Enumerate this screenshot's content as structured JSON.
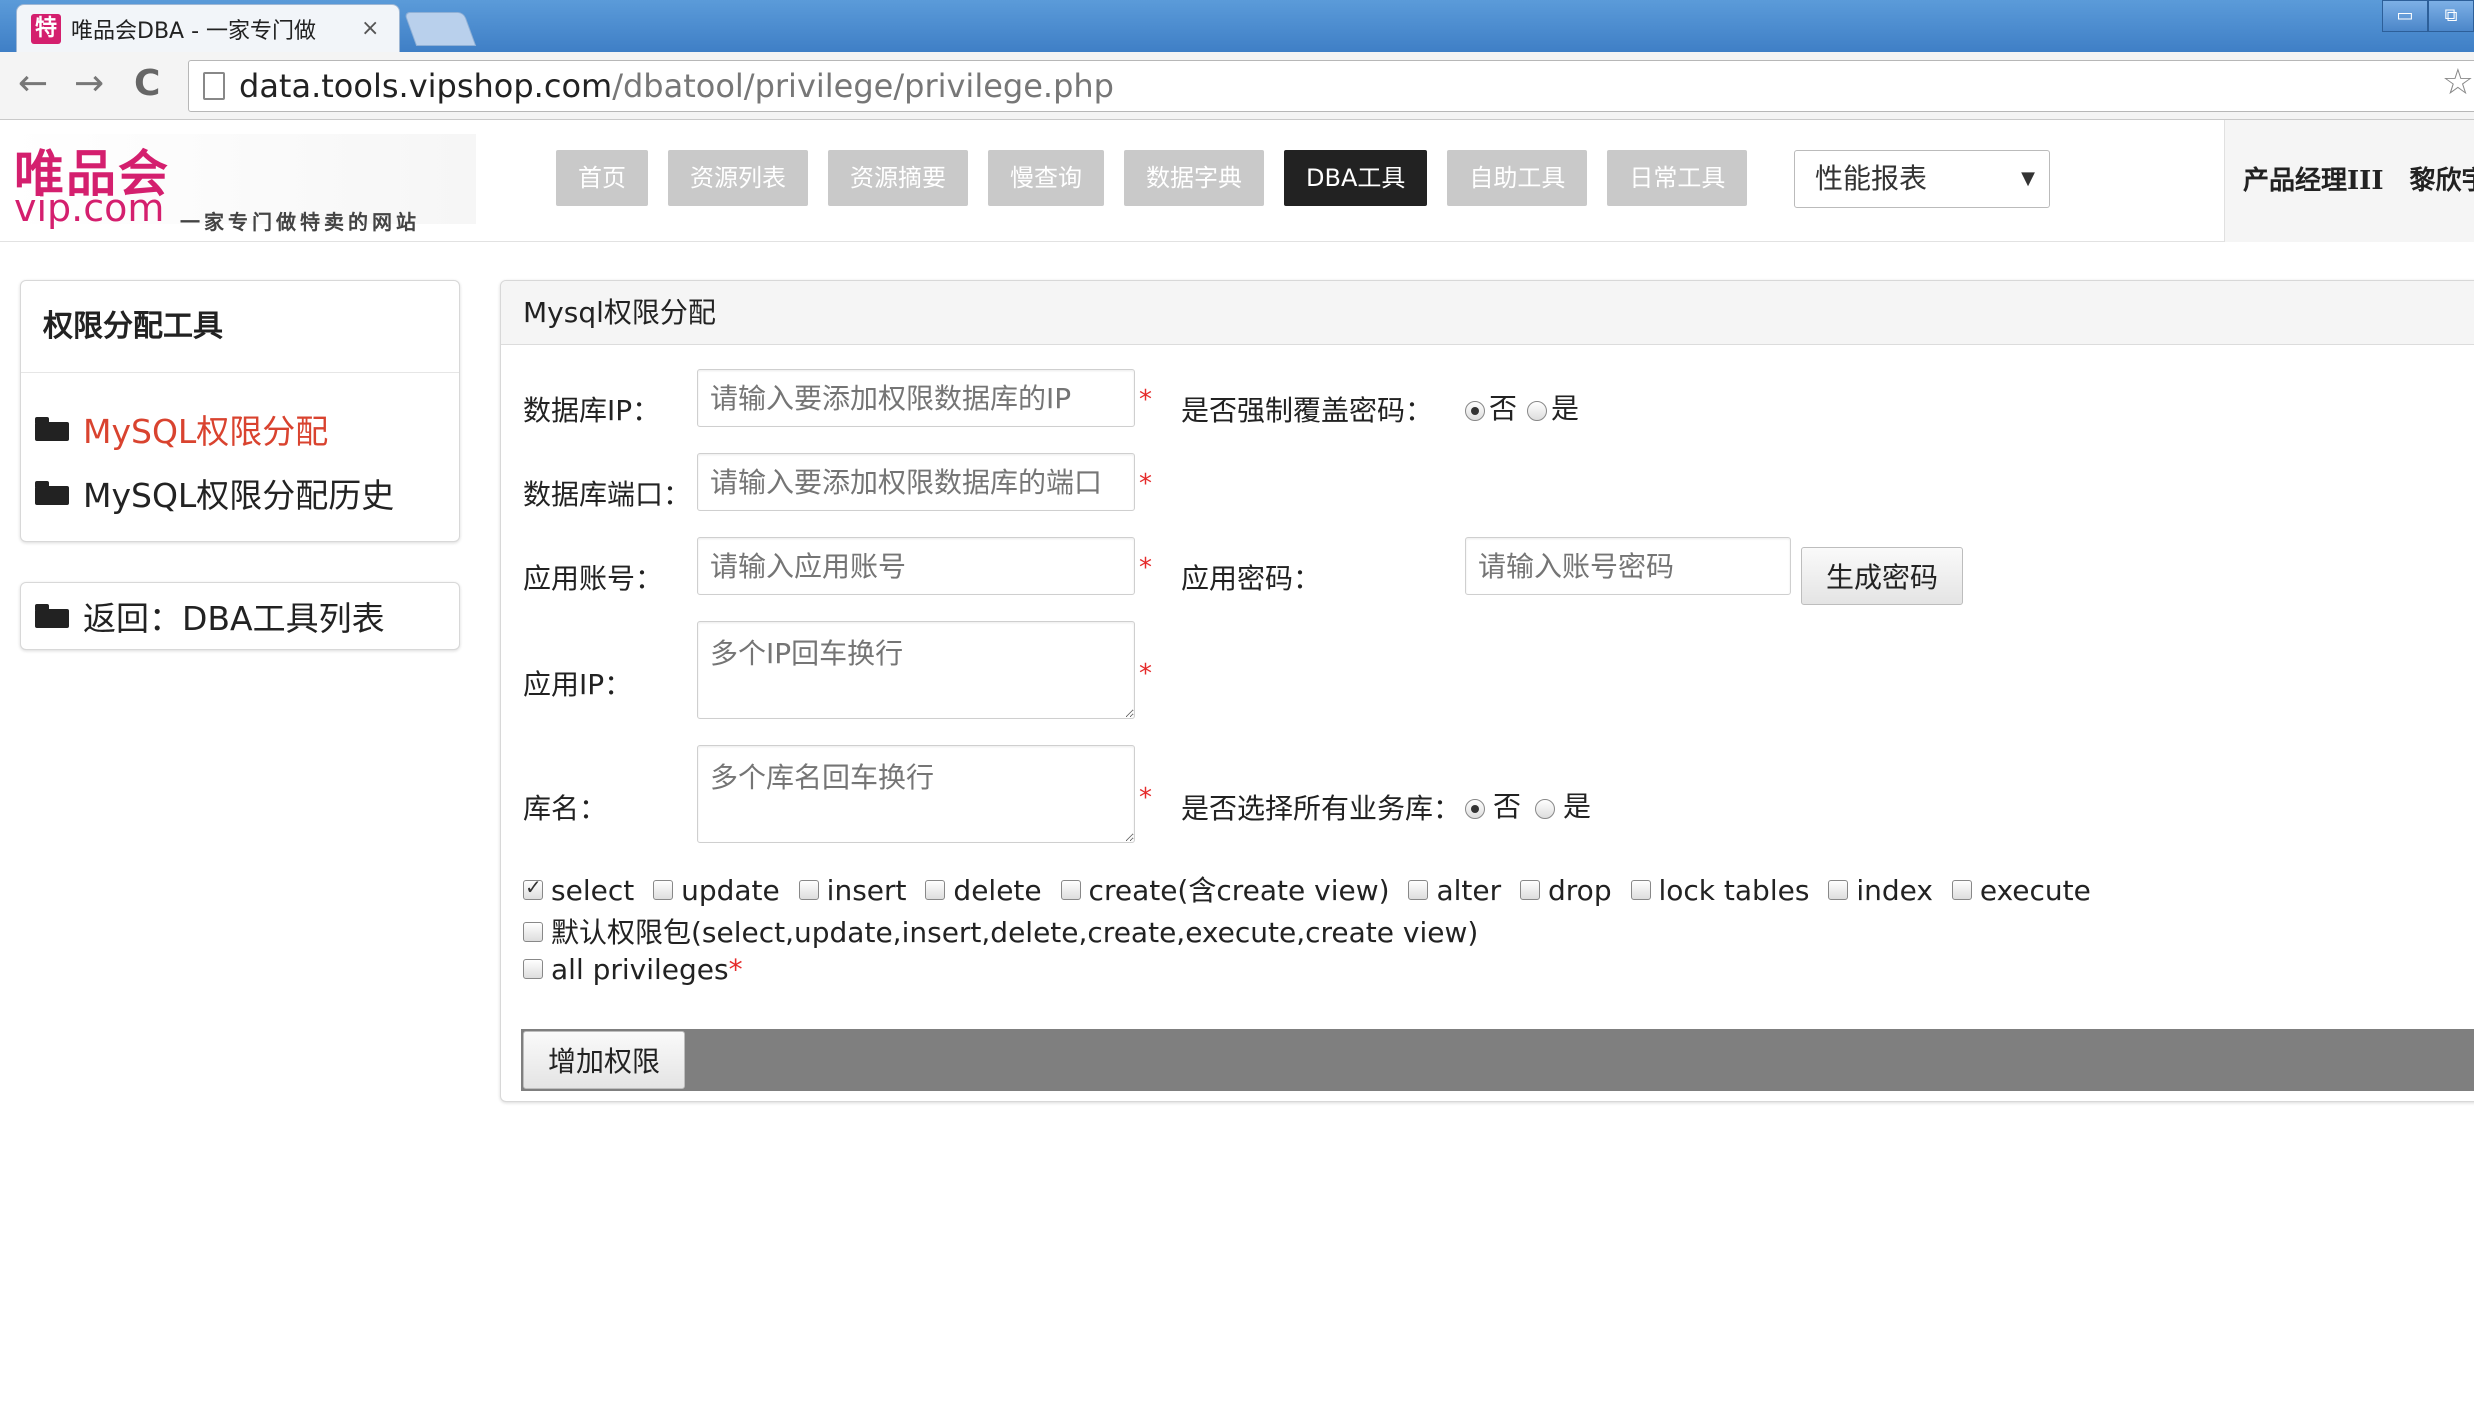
{
  "browser": {
    "tab_title": "唯品会DBA - 一家专门做",
    "favicon_text": "特",
    "close_glyph": "×",
    "url_host": "data.tools.vipshop.com",
    "url_path": "/dbatool/privilege/privilege.php",
    "back_glyph": "←",
    "forward_glyph": "→",
    "reload_glyph": "C",
    "star_glyph": "☆",
    "win_min": "▭",
    "win_restore": "⧉"
  },
  "site": {
    "logo_cn": "唯品会",
    "logo_en": "vip.com",
    "logo_slogan": "一家专门做特卖的网站",
    "nav": [
      {
        "label": "首页"
      },
      {
        "label": "资源列表"
      },
      {
        "label": "资源摘要"
      },
      {
        "label": "慢查询"
      },
      {
        "label": "数据字典"
      },
      {
        "label": "DBA工具"
      },
      {
        "label": "自助工具"
      },
      {
        "label": "日常工具"
      }
    ],
    "nav_select": "性能报表",
    "user": "产品经理III　黎欣宇"
  },
  "sidebar": {
    "title": "权限分配工具",
    "items": [
      {
        "label": "MySQL权限分配"
      },
      {
        "label": "MySQL权限分配历史"
      }
    ],
    "back_label": "返回：DBA工具列表"
  },
  "form": {
    "panel_title": "Mysql权限分配",
    "db_ip_label": "数据库IP：",
    "db_ip_placeholder": "请输入要添加权限数据库的IP",
    "force_pw_label": "是否强制覆盖密码：",
    "no": "否",
    "yes": "是",
    "db_port_label": "数据库端口：",
    "db_port_placeholder": "请输入要添加权限数据库的端口",
    "app_account_label": "应用账号：",
    "app_account_placeholder": "请输入应用账号",
    "app_pw_label": "应用密码：",
    "app_pw_placeholder": "请输入账号密码",
    "gen_pw_button": "生成密码",
    "app_ip_label": "应用IP：",
    "app_ip_placeholder": "多个IP回车换行",
    "db_name_label": "库名：",
    "db_name_placeholder": "多个库名回车换行",
    "all_db_label": "是否选择所有业务库：",
    "required_mark": "*",
    "privileges": [
      {
        "label": "select",
        "checked": true
      },
      {
        "label": "update",
        "checked": false
      },
      {
        "label": "insert",
        "checked": false
      },
      {
        "label": "delete",
        "checked": false
      },
      {
        "label": "create(含create view)",
        "checked": false
      },
      {
        "label": "alter",
        "checked": false
      },
      {
        "label": "drop",
        "checked": false
      },
      {
        "label": "lock tables",
        "checked": false
      },
      {
        "label": "index",
        "checked": false
      },
      {
        "label": "execute",
        "checked": false
      }
    ],
    "default_pack_label": "默认权限包(select,update,insert,delete,create,execute,create view)",
    "all_privileges_label": "all  privileges",
    "submit_button": "增加权限"
  },
  "colors": {
    "brand": "#d41f6e",
    "active_link": "#d9432f",
    "nav_active": "#222222",
    "nav_inactive": "#c9c9c9",
    "required": "#e52b2b"
  }
}
